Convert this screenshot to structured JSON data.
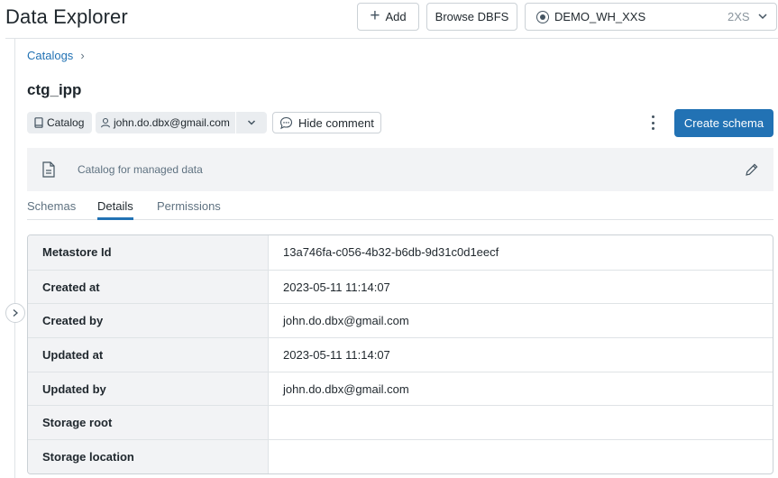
{
  "header": {
    "title": "Data Explorer",
    "add_label": "Add",
    "browse_label": "Browse DBFS",
    "warehouse": {
      "name": "DEMO_WH_XXS",
      "size": "2XS"
    }
  },
  "breadcrumb": {
    "items": [
      "Catalogs"
    ]
  },
  "catalog": {
    "name": "ctg_ipp",
    "type_tag": "Catalog",
    "owner": "john.do.dbx@gmail.com",
    "hide_comment_label": "Hide comment",
    "create_label": "Create schema",
    "comment": "Catalog for managed data"
  },
  "tabs": [
    {
      "label": "Schemas",
      "active": false
    },
    {
      "label": "Details",
      "active": true
    },
    {
      "label": "Permissions",
      "active": false
    }
  ],
  "details": [
    {
      "key": "Metastore Id",
      "value": "13a746fa-c056-4b32-b6db-9d31c0d1eecf"
    },
    {
      "key": "Created at",
      "value": "2023-05-11 11:14:07"
    },
    {
      "key": "Created by",
      "value": "john.do.dbx@gmail.com"
    },
    {
      "key": "Updated at",
      "value": "2023-05-11 11:14:07"
    },
    {
      "key": "Updated by",
      "value": "john.do.dbx@gmail.com"
    },
    {
      "key": "Storage root",
      "value": ""
    },
    {
      "key": "Storage location",
      "value": ""
    }
  ],
  "colors": {
    "primary": "#2272b4",
    "text": "#1f272d",
    "muted": "#5f7281",
    "panel": "#f2f3f5",
    "border": "#cbd1d6"
  },
  "icons": {
    "add": "plus-icon",
    "warehouse": "circle-status-icon",
    "dropdown": "chevron-down-icon",
    "catalog": "book-icon",
    "owner": "user-icon",
    "comment": "speech-bubble-icon",
    "more": "kebab-icon",
    "doc": "document-icon",
    "edit": "pencil-icon",
    "sidebar": "chevron-right-icon"
  }
}
